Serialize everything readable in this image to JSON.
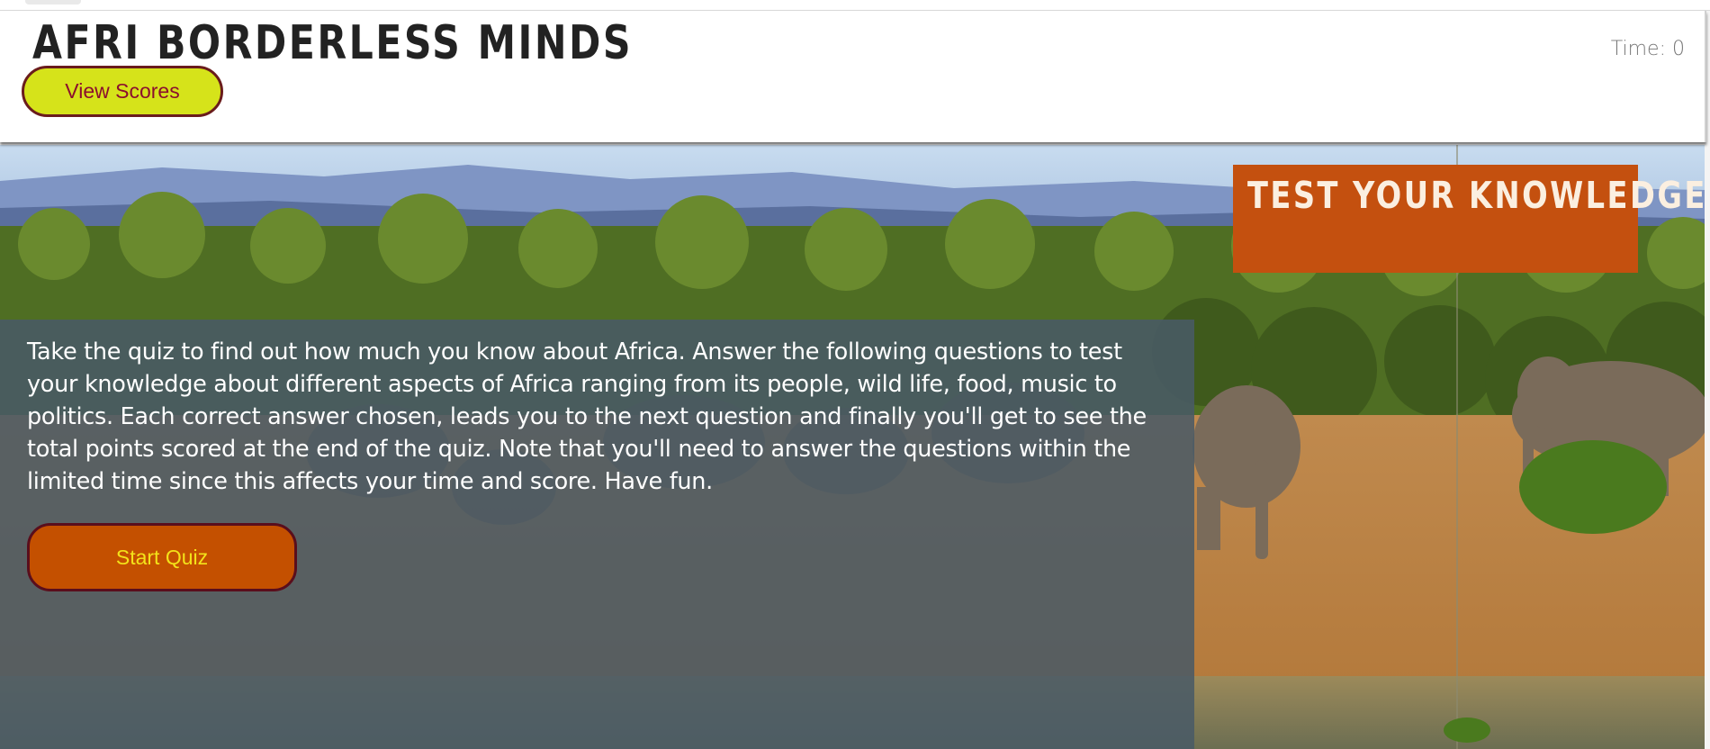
{
  "header": {
    "site_title": "AFRI BORDERLESS MINDS",
    "view_scores_label": "View Scores",
    "timer_text": "Time: 0"
  },
  "hero": {
    "heading": "TEST YOUR KNOWLEDGE ABOUT AFRICA",
    "intro_text": "Take the quiz to find out how much you know about Africa. Answer the following questions to test your knowledge about different aspects of Africa ranging from its people, wild life, food, music to politics. Each correct answer chosen, leads you to the next question and finally you'll get to see the total points scored at the end of the quiz. Note that you'll need to answer the questions within the limited time since this affects your time and score. Have fun.",
    "start_quiz_label": "Start Quiz",
    "background_image": "elephants-savanna-photo"
  },
  "colors": {
    "view_scores_bg": "#d6e31a",
    "view_scores_text": "#8b0f2e",
    "start_quiz_bg": "#c45000",
    "start_quiz_text": "#f3e21a",
    "heading_box_bg": "#c4500f",
    "panel_bg": "#485a66"
  }
}
